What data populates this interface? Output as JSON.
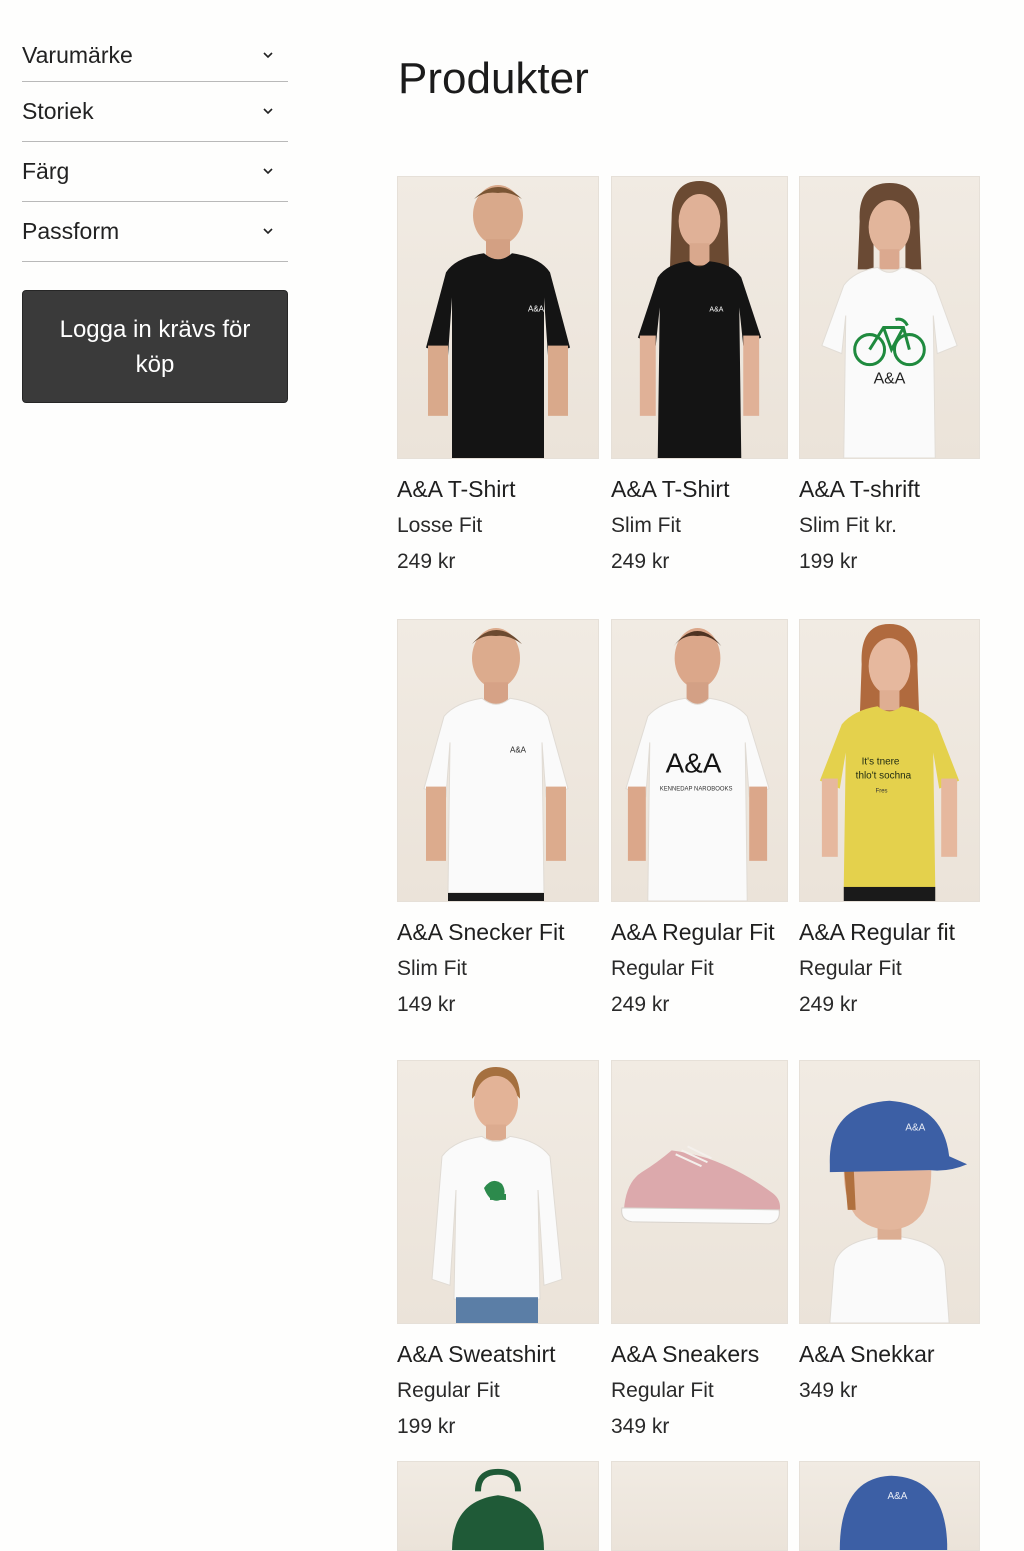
{
  "filters": [
    {
      "label": "Varumärke"
    },
    {
      "label": "Storiek"
    },
    {
      "label": "Färg"
    },
    {
      "label": "Passform"
    }
  ],
  "login_button": {
    "label": "Logga in krävs för köp"
  },
  "page_title": "Produkter",
  "products": [
    {
      "name": "A&A T-Shirt",
      "sub": "Losse Fit",
      "price": "249 kr",
      "image": "man-black-tshirt",
      "print": "A&A"
    },
    {
      "name": "A&A T-Shirt",
      "sub": "Slim Fit",
      "price": "249 kr",
      "image": "woman-black-tshirt",
      "print": "A&A"
    },
    {
      "name": "A&A T-shrift",
      "sub": "Slim Fit kr.",
      "price": "199 kr",
      "image": "woman-white-bicycle-tshirt",
      "print": "A&A"
    },
    {
      "name": "A&A Snecker Fit",
      "sub": "Slim Fit",
      "price": "149 kr",
      "image": "man-white-tshirt",
      "print": "A&A"
    },
    {
      "name": "A&A Regular Fit",
      "sub": "Regular Fit",
      "price": "249 kr",
      "image": "man-white-logo-tshirt",
      "print": "A&A",
      "print2": "KENNEDAP NAROBOOKS"
    },
    {
      "name": "A&A Regular fit",
      "sub": "Regular Fit",
      "price": "249 kr",
      "image": "woman-yellow-tshirt",
      "print": "It's tnere",
      "print2": "thlo't sochna",
      "print3": "Fres"
    },
    {
      "name": "A&A Sweatshirt",
      "sub": "Regular Fit",
      "price": "199 kr",
      "image": "boy-white-sweatshirt"
    },
    {
      "name": "A&A Sneakers",
      "sub": "Regular Fit",
      "price": "349 kr",
      "image": "pink-sneaker"
    },
    {
      "name": "A&A Snekkar",
      "sub": "349 kr",
      "price": "",
      "image": "girl-blue-cap",
      "print": "A&A"
    },
    {
      "image": "green-backpack"
    },
    {
      "image": "empty-product"
    },
    {
      "image": "blue-cap",
      "print": "A&A"
    }
  ],
  "colors": {
    "button_bg": "#3a3a3a",
    "black_tee": "#141414",
    "white_tee": "#fafafa",
    "yellow_tee": "#e4d14c",
    "cap_blue": "#3c5fa5",
    "bike_green": "#1f8a3e",
    "backpack_green": "#1f5a37",
    "sneaker_pink": "#dca9ac"
  }
}
